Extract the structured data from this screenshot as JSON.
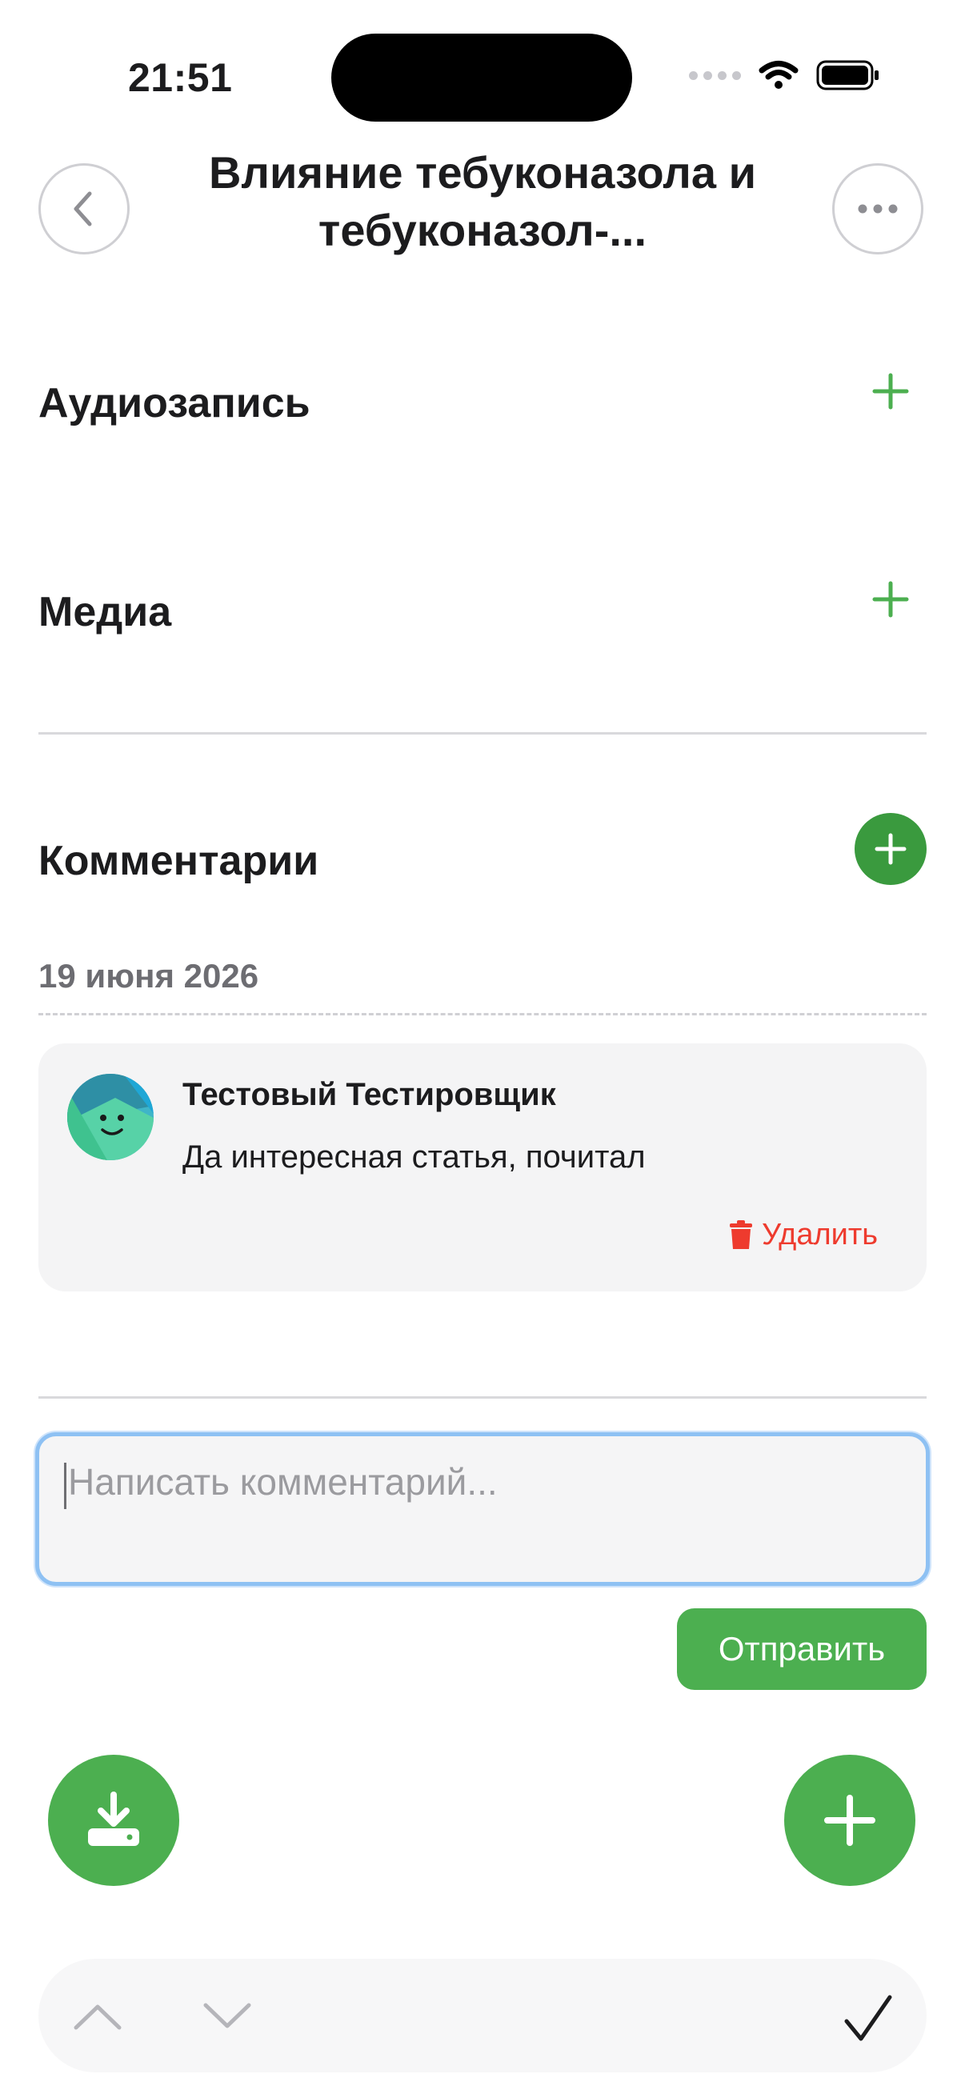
{
  "status_bar": {
    "time": "21:51"
  },
  "header": {
    "title": "Влияние тебуконазола и тебуконазол-..."
  },
  "sections": {
    "audio_title": "Аудиозапись",
    "media_title": "Медиа",
    "comments_title": "Комментарии"
  },
  "comments": {
    "date": "19 июня 2026",
    "items": [
      {
        "author": "Тестовый Тестировщик",
        "text": "Да интересная статья, почитал",
        "delete_label": "Удалить"
      }
    ]
  },
  "composer": {
    "placeholder": "Написать комментарий...",
    "value": "",
    "send_label": "Отправить"
  },
  "icons": {
    "back": "chevron-left-icon",
    "more": "ellipsis-icon",
    "add": "plus-icon",
    "delete": "trash-icon",
    "download": "download-icon",
    "up": "chevron-up-icon",
    "down": "chevron-down-icon",
    "done": "checkmark-icon"
  },
  "colors": {
    "accent": "#4caf50",
    "accent_dark": "#3a9a3e",
    "danger": "#ee3b2e",
    "focus": "#8ec1f3"
  }
}
